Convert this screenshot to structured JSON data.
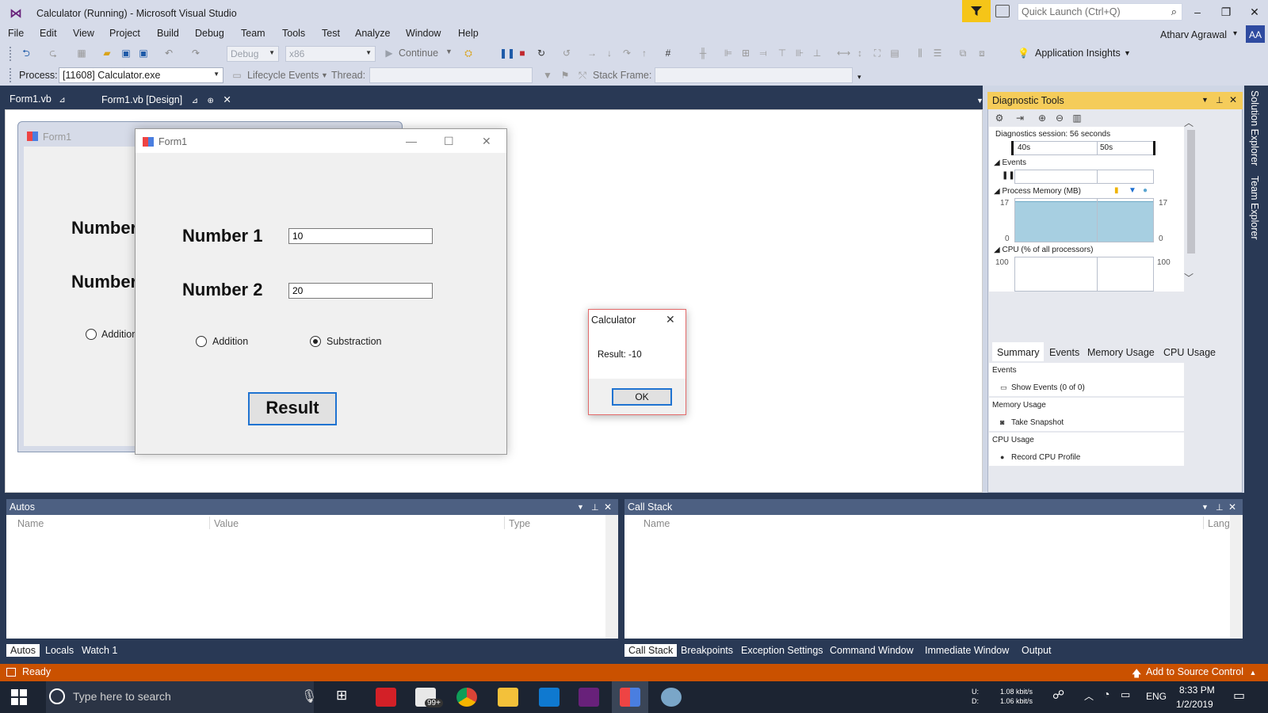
{
  "window": {
    "title": "Calculator (Running) - Microsoft Visual Studio",
    "quick_launch_placeholder": "Quick Launch (Ctrl+Q)",
    "user": "Atharv Agrawal",
    "avatar_initials": "AA"
  },
  "menu": [
    "File",
    "Edit",
    "View",
    "Project",
    "Build",
    "Debug",
    "Team",
    "Tools",
    "Test",
    "Analyze",
    "Window",
    "Help"
  ],
  "toolbar": {
    "config": "Debug",
    "platform": "x86",
    "continue_label": "Continue",
    "insights_label": "Application Insights",
    "process_label": "Process:",
    "process_value": "[11608] Calculator.exe",
    "lifecycle_label": "Lifecycle Events",
    "thread_label": "Thread:",
    "stack_frame_label": "Stack Frame:"
  },
  "doc_tabs": [
    {
      "label": "Form1.vb",
      "active": false
    },
    {
      "label": "Form1.vb [Design]",
      "active": true
    }
  ],
  "designer_form": {
    "title": "Form1",
    "label1": "Number",
    "label2": "Number",
    "radio_label": "Addition"
  },
  "running_form": {
    "title": "Form1",
    "number1_label": "Number 1",
    "number1_value": "10",
    "number2_label": "Number 2",
    "number2_value": "20",
    "radio_addition": "Addition",
    "radio_subtraction": "Substraction",
    "selected_operation": "Substraction",
    "result_button": "Result"
  },
  "message_box": {
    "title": "Calculator",
    "text": "Result: -10",
    "ok_label": "OK"
  },
  "diagnostics": {
    "title": "Diagnostic Tools",
    "session": "Diagnostics session: 56 seconds",
    "timeline_ticks": [
      "40s",
      "50s"
    ],
    "events_label": "Events",
    "memory_label": "Process Memory (MB)",
    "memory_max": "17",
    "memory_min": "0",
    "memory_level": 0.94,
    "cpu_label": "CPU (% of all processors)",
    "cpu_max": "100",
    "tabs": [
      "Summary",
      "Events",
      "Memory Usage",
      "CPU Usage"
    ],
    "summary": {
      "events_head": "Events",
      "show_events": "Show Events (0 of 0)",
      "memory_head": "Memory Usage",
      "take_snapshot": "Take Snapshot",
      "cpu_head": "CPU Usage",
      "record_cpu": "Record CPU Profile"
    },
    "accent_color": "#f5cc5a"
  },
  "right_tabs": [
    "Solution Explorer",
    "Team Explorer"
  ],
  "autos": {
    "title": "Autos",
    "columns": [
      "Name",
      "Value",
      "Type"
    ],
    "tabs": [
      "Autos",
      "Locals",
      "Watch 1"
    ]
  },
  "callstack": {
    "title": "Call Stack",
    "columns": [
      "Name",
      "Lang"
    ],
    "tabs": [
      "Call Stack",
      "Breakpoints",
      "Exception Settings",
      "Command Window",
      "Immediate Window",
      "Output"
    ]
  },
  "status": {
    "text": "Ready",
    "source_control": "Add to Source Control",
    "color": "#ca5100"
  },
  "taskbar": {
    "search_placeholder": "Type here to search",
    "mail_badge": "99+",
    "net_up_label": "U:",
    "net_down_label": "D:",
    "net_up": "1.08 kbit/s",
    "net_down": "1.06 kbit/s",
    "language": "ENG",
    "time": "8:33 PM",
    "date": "1/2/2019"
  }
}
